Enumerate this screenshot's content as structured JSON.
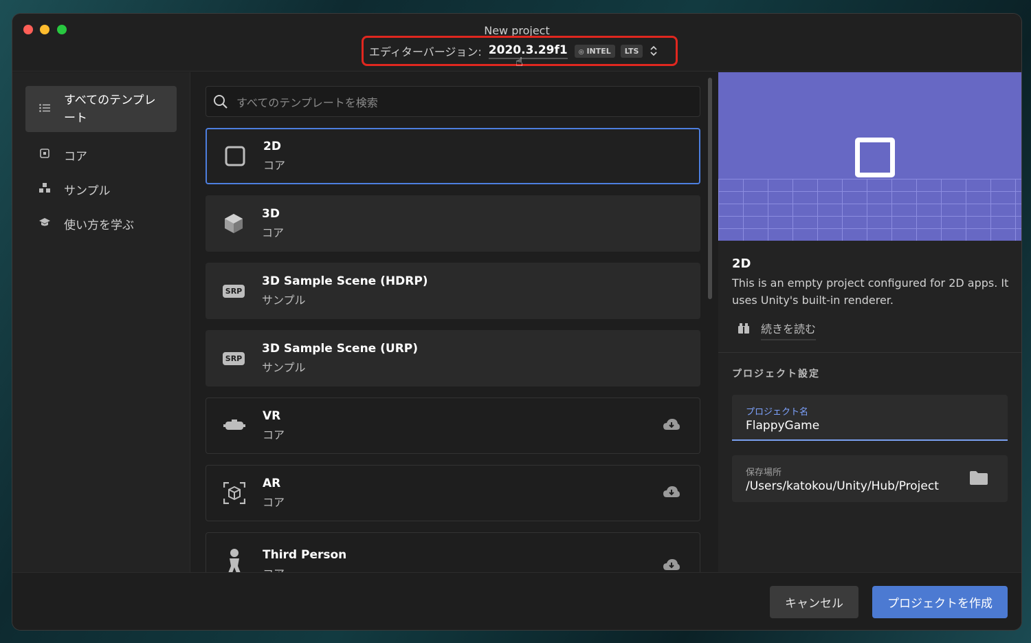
{
  "window": {
    "title": "New project"
  },
  "version": {
    "label": "エディターバージョン:",
    "value": "2020.3.29f1",
    "chips": [
      "INTEL",
      "LTS"
    ]
  },
  "sidebar": {
    "items": [
      {
        "label": "すべてのテンプレート",
        "icon": "list-icon",
        "active": true
      },
      {
        "label": "コア",
        "icon": "core-icon"
      },
      {
        "label": "サンプル",
        "icon": "sample-icon"
      },
      {
        "label": "使い方を学ぶ",
        "icon": "learn-icon"
      }
    ]
  },
  "search": {
    "placeholder": "すべてのテンプレートを検索"
  },
  "templates": [
    {
      "title": "2D",
      "category": "コア",
      "icon": "square-icon",
      "selected": true
    },
    {
      "title": "3D",
      "category": "コア",
      "icon": "cube-icon"
    },
    {
      "title": "3D Sample Scene (HDRP)",
      "category": "サンプル",
      "icon": "srp-icon",
      "badge": "SRP"
    },
    {
      "title": "3D Sample Scene (URP)",
      "category": "サンプル",
      "icon": "srp-icon",
      "badge": "SRP"
    },
    {
      "title": "VR",
      "category": "コア",
      "icon": "vr-headset-icon",
      "download": true
    },
    {
      "title": "AR",
      "category": "コア",
      "icon": "ar-icon",
      "download": true
    },
    {
      "title": "Third Person",
      "category": "コア",
      "icon": "person-icon",
      "download": true
    }
  ],
  "detail": {
    "title": "2D",
    "description": "This is an empty project configured for 2D apps. It uses Unity's built-in renderer.",
    "read_more": "続きを読む"
  },
  "settings": {
    "heading": "プロジェクト設定",
    "project_name_label": "プロジェクト名",
    "project_name_value": "FlappyGame",
    "location_label": "保存場所",
    "location_value": "/Users/katokou/Unity/Hub/Project"
  },
  "footer": {
    "cancel_label": "キャンセル",
    "create_label": "プロジェクトを作成"
  },
  "colors": {
    "accent": "#4c7ad2",
    "highlight_border": "#e0271f",
    "preview_bg": "#6768c4"
  }
}
